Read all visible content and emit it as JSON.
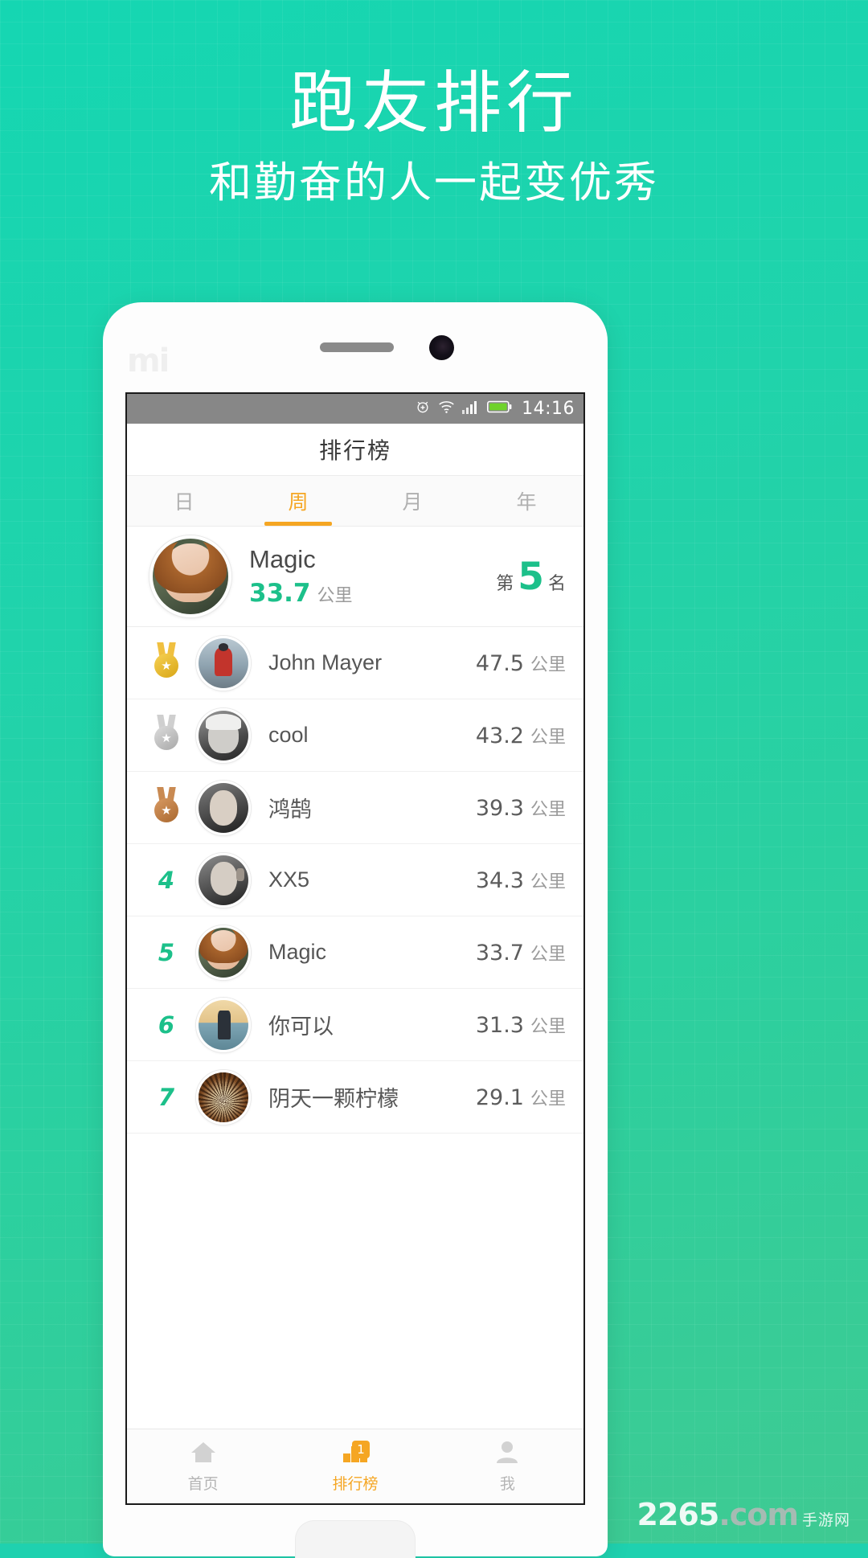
{
  "promo": {
    "title": "跑友排行",
    "subtitle": "和勤奋的人一起变优秀"
  },
  "phone": {
    "brand_logo": "mi-logo",
    "status_bar": {
      "time": "14:16",
      "icons": [
        "alarm-icon",
        "wifi-icon",
        "signal-icon",
        "battery-icon"
      ],
      "battery_color": "#6fd22b"
    }
  },
  "app": {
    "title": "排行榜",
    "tabs": [
      {
        "label": "日",
        "active": false
      },
      {
        "label": "周",
        "active": true
      },
      {
        "label": "月",
        "active": false
      },
      {
        "label": "年",
        "active": false
      }
    ],
    "accent_orange": "#f5a623",
    "accent_green": "#1cc08a",
    "self_card": {
      "name": "Magic",
      "distance": "33.7",
      "unit": "公里",
      "rank_prefix": "第",
      "rank_number": "5",
      "rank_suffix": "名"
    },
    "unit": "公里",
    "rows": [
      {
        "rank": "1",
        "medal": "gold",
        "name": "John Mayer",
        "distance": "47.5",
        "unit": "公里"
      },
      {
        "rank": "2",
        "medal": "silver",
        "name": "cool",
        "distance": "43.2",
        "unit": "公里"
      },
      {
        "rank": "3",
        "medal": "bronze",
        "name": "鸿鹄",
        "distance": "39.3",
        "unit": "公里"
      },
      {
        "rank": "4",
        "medal": "",
        "name": "XX5",
        "distance": "34.3",
        "unit": "公里"
      },
      {
        "rank": "5",
        "medal": "",
        "name": "Magic",
        "distance": "33.7",
        "unit": "公里"
      },
      {
        "rank": "6",
        "medal": "",
        "name": "你可以",
        "distance": "31.3",
        "unit": "公里"
      },
      {
        "rank": "7",
        "medal": "",
        "name": "阴天一颗柠檬",
        "distance": "29.1",
        "unit": "公里"
      }
    ],
    "bottom_nav": [
      {
        "label": "首页",
        "icon": "home-icon",
        "active": false,
        "badge": ""
      },
      {
        "label": "排行榜",
        "icon": "leaderboard-icon",
        "active": true,
        "badge": "1"
      },
      {
        "label": "我",
        "icon": "person-icon",
        "active": false,
        "badge": ""
      }
    ]
  },
  "watermark": {
    "number": "2265",
    "domain": ".com",
    "cn": "手游网"
  }
}
